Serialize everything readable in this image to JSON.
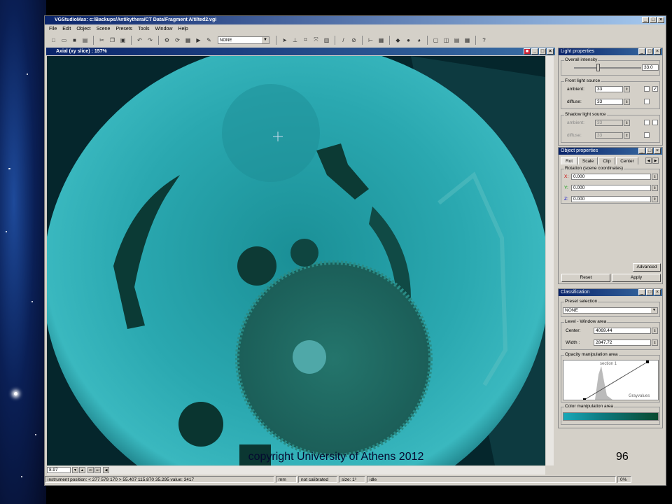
{
  "window": {
    "title": "VGStudioMax: c:/Backups/Antikythera/CT Data/Fragment A/tilted2.vgi"
  },
  "menu": [
    "File",
    "Edit",
    "Object",
    "Scene",
    "Presets",
    "Tools",
    "Window",
    "Help"
  ],
  "toolbar": {
    "preset_value": "NONE"
  },
  "view": {
    "title": "Axial (xy slice) : 157%",
    "zoom_field": "8.97"
  },
  "light_properties": {
    "title": "Light properties",
    "overall_intensity_label": "Overall intensity",
    "overall_intensity_value": "33.0",
    "front_light_label": "Front light source",
    "ambient_label": "ambient:",
    "ambient_value": "33",
    "diffuse_label": "diffuse:",
    "diffuse_value": "33",
    "shadow_light_label": "Shadow light source",
    "shadow_ambient_label": "ambient:",
    "shadow_ambient_value": "33",
    "shadow_diffuse_label": "diffuse:",
    "shadow_diffuse_value": "33"
  },
  "object_properties": {
    "title": "Object properties",
    "tabs": [
      "Rot",
      "Scale",
      "Clip",
      "Center"
    ],
    "rotation_label": "Rotation (scene coordinates)",
    "x_label": "X:",
    "x_value": "0.000",
    "y_label": "Y:",
    "y_value": "0.000",
    "z_label": "Z:",
    "z_value": "0.000",
    "advanced_label": "Advanced",
    "reset_label": "Reset",
    "apply_label": "Apply"
  },
  "classification": {
    "title": "Classification",
    "preset_selection_label": "Preset selection",
    "preset_value": "NONE",
    "level_window_label": "Level - Window area",
    "center_label": "Center:",
    "center_value": "4069.44",
    "width_label": "Width :",
    "width_value": "2847.72",
    "opacity_label": "Opacity manipulation area",
    "section_label": "section 1",
    "grayvalues_label": "Grayvalues",
    "color_label": "Color manipulation area"
  },
  "status": {
    "instrument_position": "instrument position: < 277 579 170 > 55.407 115.870 35.295 value: 3417",
    "unit": "mm",
    "calibration": "not calibrated",
    "size": "size: 1³",
    "state": "idle",
    "progress": "0%"
  },
  "slide": {
    "copyright": "copyright University of Athens 2012",
    "number": "96"
  },
  "colors": {
    "title_bar": "#0a246a",
    "specimen_teal": "#2aa8b0",
    "chrome": "#d4d0c8"
  }
}
